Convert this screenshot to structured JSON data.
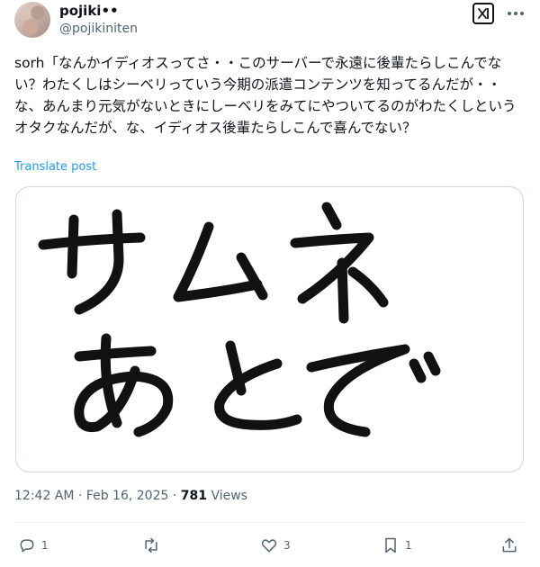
{
  "author": {
    "display_name": "pojiki••",
    "handle": "@pojikiniten"
  },
  "tweet": {
    "text": "sorh「なんかイディオスってさ・・このサーバーで永遠に後輩たらしこんでない？わたくしはシーベリっていう今期の派遣コンテンツを知ってるんだが・・な、あんまり元気がないときにしーベリをみてにやついてるのがわたくしというオタクなんだが、な、イディオス後輩たらしこんで喜んでない？",
    "translate_label": "Translate post",
    "image_text": {
      "line1": "サムネ",
      "line2": "あとで"
    }
  },
  "meta": {
    "time": "12:42 AM",
    "separator": "·",
    "date": "Feb 16, 2025",
    "views_count": "781",
    "views_label": "Views"
  },
  "actions": {
    "reply_count": "1",
    "repost_count": "",
    "like_count": "3",
    "bookmark_count": "1"
  },
  "colors": {
    "text": "#0f1419",
    "secondary": "#536471",
    "link": "#1d9bf0",
    "border": "#cfd9de"
  },
  "icons": [
    "grok-icon",
    "more-icon",
    "reply-icon",
    "repost-icon",
    "like-icon",
    "bookmark-icon",
    "share-icon"
  ]
}
